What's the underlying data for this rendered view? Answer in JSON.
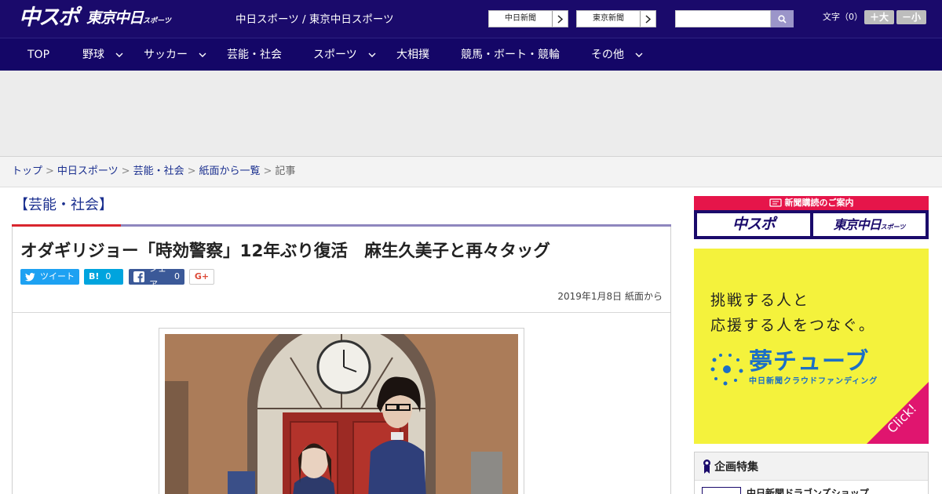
{
  "header": {
    "logo_chuspo": "中スポ",
    "logo_tokyo": "東京中日",
    "logo_tokyo_small": "スポーツ",
    "site_title": "中日スポーツ / 東京中日スポーツ",
    "paper_links": [
      "中日新聞",
      "東京新聞"
    ],
    "search": {
      "value": "",
      "placeholder": ""
    },
    "font_label": "文字（0）",
    "font_bigger": "＋大",
    "font_smaller": "－小"
  },
  "nav": {
    "items": [
      {
        "label": "TOP",
        "dropdown": false
      },
      {
        "label": "野球",
        "dropdown": true
      },
      {
        "label": "サッカー",
        "dropdown": true
      },
      {
        "label": "芸能・社会",
        "dropdown": false
      },
      {
        "label": "スポーツ",
        "dropdown": true
      },
      {
        "label": "大相撲",
        "dropdown": false
      },
      {
        "label": "競馬・ボート・競輪",
        "dropdown": false
      },
      {
        "label": "その他",
        "dropdown": true
      }
    ]
  },
  "breadcrumb": {
    "items": [
      "トップ",
      "中日スポーツ",
      "芸能・社会",
      "紙面から一覧"
    ],
    "current": "記事",
    "separator": ">"
  },
  "article": {
    "category": "【芸能・社会】",
    "headline": "オダギリジョー「時効警察」12年ぶり復活　麻生久美子と再々タッグ",
    "share": {
      "tweet_label": "ツイート",
      "hatena_label": "B!",
      "hatena_count": "0",
      "facebook_label": "シェア",
      "facebook_count": "0",
      "gplus_label": "G+"
    },
    "date": "2019年1月8日 紙面から"
  },
  "sidebar": {
    "subscription": {
      "heading": "新聞購読のご案内",
      "tile_chuspo": "中スポ",
      "tile_tokyo": "東京中日",
      "tile_tokyo_small": "スポーツ"
    },
    "banner": {
      "line1": "挑戦する人と",
      "line2": "応援する人をつなぐ。",
      "brand": "夢チューブ",
      "sub": "中日新聞クラウドファンディング",
      "click": "Click!"
    },
    "special": {
      "title": "企画特集",
      "item": "中日新聞ドラゴンズショップ"
    }
  },
  "colors": {
    "header_bg": "#1a0a6b",
    "nav_bg": "#140667",
    "link": "#1a2f8f",
    "accent_red": "#d9262e",
    "banner_yellow": "#f4f23c",
    "banner_blue": "#1b6fc7",
    "twitter": "#1da1f2",
    "hatena": "#00a4de",
    "facebook": "#3b5998"
  },
  "icons": [
    "search-icon",
    "chevron-right-icon",
    "chevron-down-icon",
    "twitter-icon",
    "facebook-icon",
    "ticket-icon",
    "ribbon-icon"
  ]
}
